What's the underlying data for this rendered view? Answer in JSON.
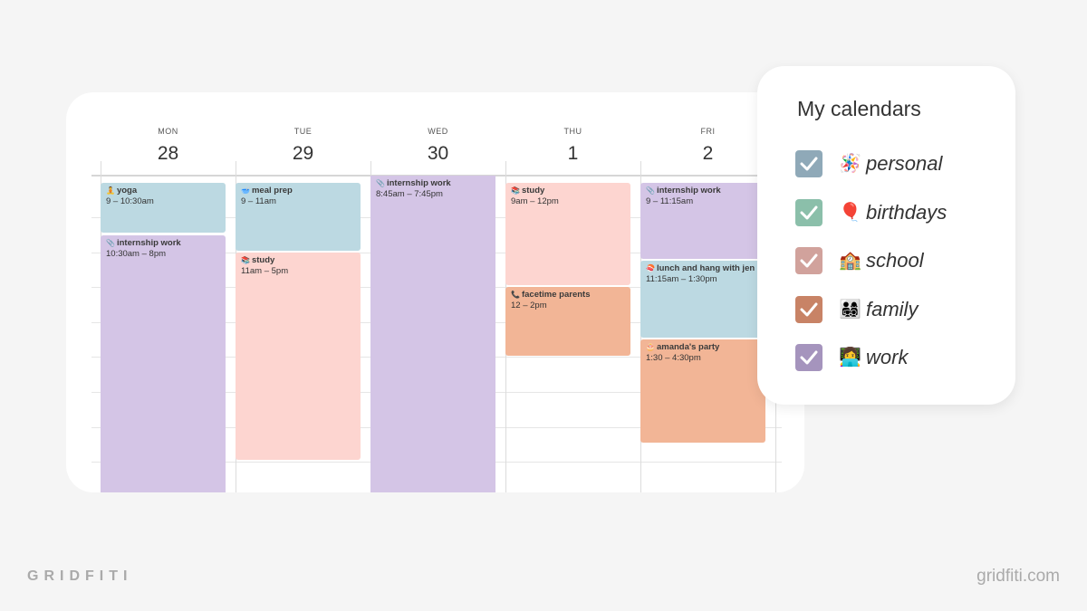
{
  "calendar": {
    "days": [
      {
        "dow": "MON",
        "date": "28"
      },
      {
        "dow": "TUE",
        "date": "29"
      },
      {
        "dow": "WED",
        "date": "30"
      },
      {
        "dow": "THU",
        "date": "1"
      },
      {
        "dow": "FRI",
        "date": "2"
      }
    ],
    "events": [
      {
        "day": "MON",
        "icon": "🧘",
        "title": "yoga",
        "time": "9 – 10:30am",
        "calendar": "personal"
      },
      {
        "day": "MON",
        "icon": "📎",
        "title": "internship work",
        "time": "10:30am – 8pm",
        "calendar": "work"
      },
      {
        "day": "TUE",
        "icon": "🥣",
        "title": "meal prep",
        "time": "9 – 11am",
        "calendar": "personal"
      },
      {
        "day": "TUE",
        "icon": "📚",
        "title": "study",
        "time": "11am – 5pm",
        "calendar": "school"
      },
      {
        "day": "WED",
        "icon": "📎",
        "title": "internship work",
        "time": "8:45am – 7:45pm",
        "calendar": "work"
      },
      {
        "day": "THU",
        "icon": "📚",
        "title": "study",
        "time": "9am – 12pm",
        "calendar": "school"
      },
      {
        "day": "THU",
        "icon": "📞",
        "title": "facetime parents",
        "time": "12 – 2pm",
        "calendar": "family"
      },
      {
        "day": "FRI",
        "icon": "📎",
        "title": "internship work",
        "time": "9 – 11:15am",
        "calendar": "work"
      },
      {
        "day": "FRI",
        "icon": "🍣",
        "title": "lunch and hang with jen",
        "time": "11:15am – 1:30pm",
        "calendar": "personal"
      },
      {
        "day": "FRI",
        "icon": "🎂",
        "title": "amanda's party",
        "time": "1:30 – 4:30pm",
        "calendar": "family"
      }
    ]
  },
  "my_calendars": {
    "title": "My calendars",
    "items": [
      {
        "label": "personal",
        "emoji": "🪅",
        "color": "#8fa9b8",
        "checked": true
      },
      {
        "label": "birthdays",
        "emoji": "🎈",
        "color": "#8bbfaa",
        "checked": true
      },
      {
        "label": "school",
        "emoji": "🏫",
        "color": "#d1a29c",
        "checked": true
      },
      {
        "label": "family",
        "emoji": "👨‍👩‍👧‍👦",
        "color": "#c88366",
        "checked": true
      },
      {
        "label": "work",
        "emoji": "👩‍💻",
        "color": "#a594bd",
        "checked": true
      }
    ]
  },
  "branding": {
    "left": "GRIDFITI",
    "right": "gridfiti.com"
  }
}
